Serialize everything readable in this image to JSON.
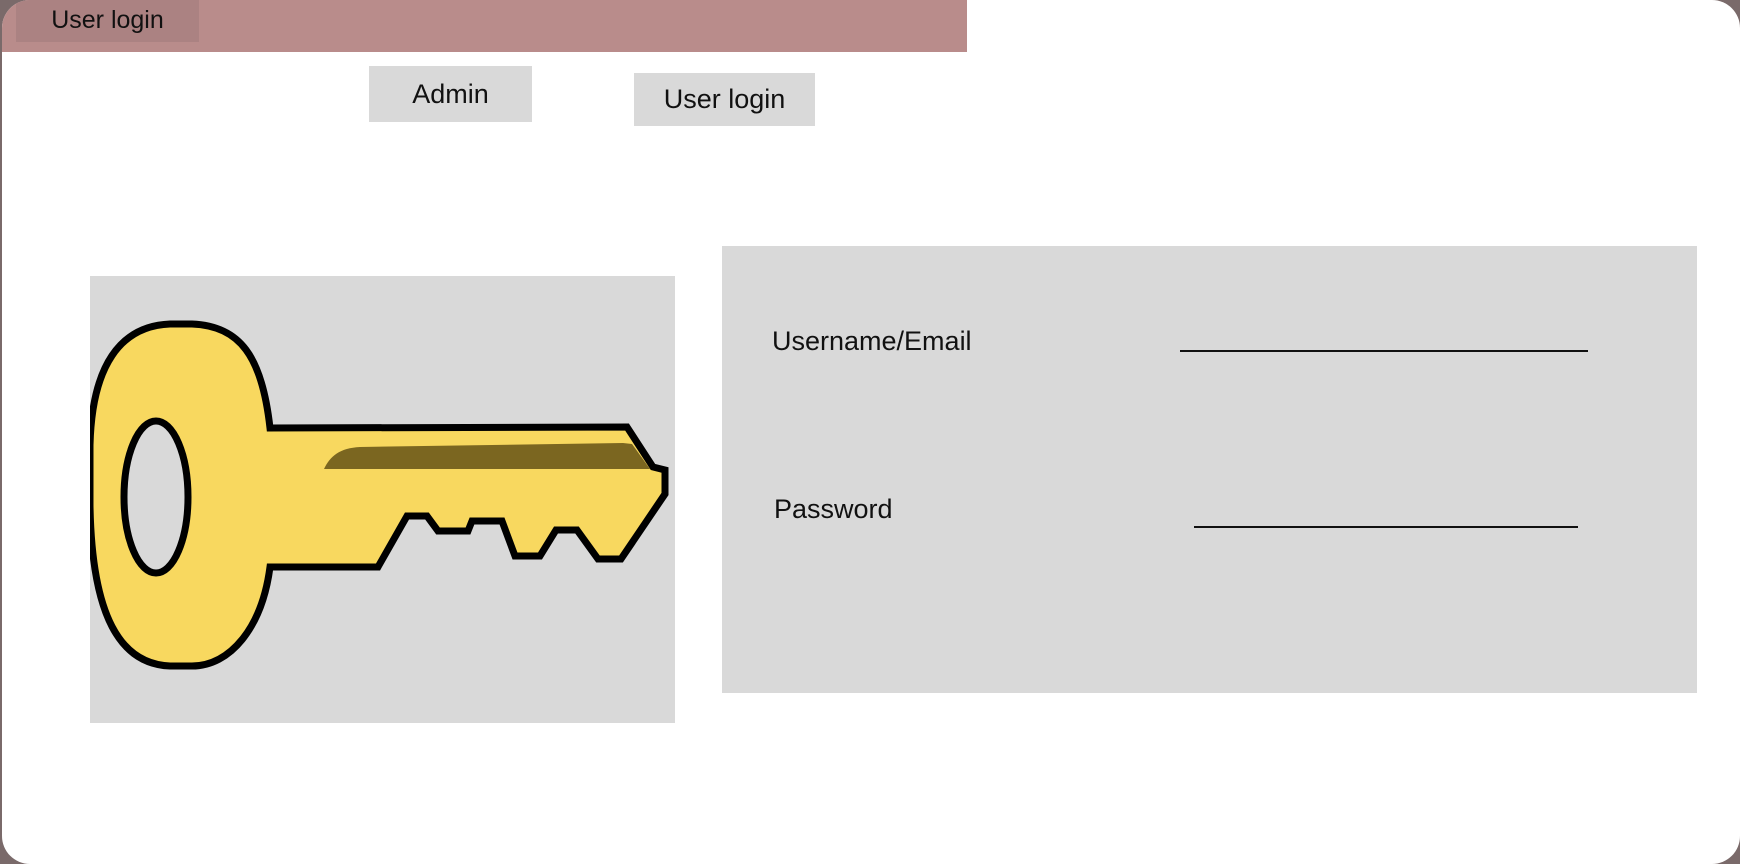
{
  "window": {
    "title_tab": "User login"
  },
  "nav": {
    "admin_label": "Admin",
    "user_login_label": "User login"
  },
  "illustration": {
    "icon": "key-icon",
    "colors": {
      "key_fill": "#f8d85f",
      "key_shadow": "#7b6620",
      "outline": "#000000"
    }
  },
  "form": {
    "username_label": "Username/Email",
    "username_value": "",
    "password_label": "Password",
    "password_value": ""
  },
  "colors": {
    "titlebar": "#b98c8b",
    "panel": "#d9d9d9",
    "background": "#ffffff"
  }
}
